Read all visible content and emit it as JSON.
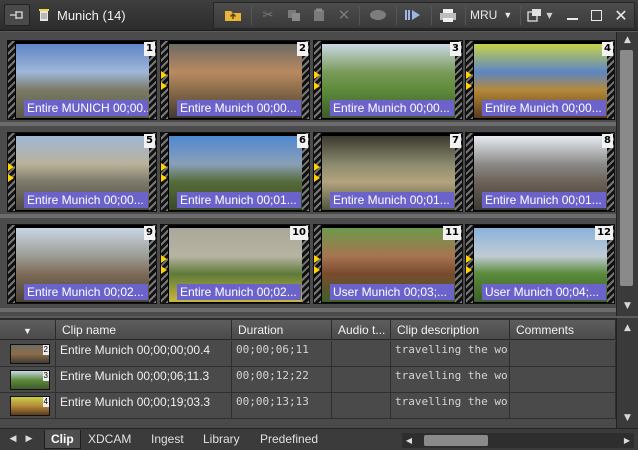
{
  "window": {
    "title": "Munich (14)",
    "mru_label": "MRU"
  },
  "icons": {
    "pin": "pin-icon",
    "trash": "trash-icon",
    "up_folder": "up-folder-icon",
    "cut": "cut-icon",
    "copy": "copy-icon",
    "paste": "paste-icon",
    "delete": "delete-icon",
    "record": "record-icon",
    "send": "send-icon",
    "print": "print-icon",
    "view": "view-options-icon",
    "minimize": "minimize-icon",
    "maximize": "maximize-icon",
    "close": "close-icon"
  },
  "clips": [
    {
      "num": "1",
      "label": "Entire MUNICH 00;00...",
      "palette": [
        "#5f86c7",
        "#9fb7d9",
        "#7a7a66",
        "#5b5a4a"
      ]
    },
    {
      "num": "2",
      "label": "Entire Munich 00;00...",
      "palette": [
        "#6f6b63",
        "#b98a62",
        "#8c6d4a",
        "#403a33"
      ]
    },
    {
      "num": "3",
      "label": "Entire Munich 00;00...",
      "palette": [
        "#c9d8e4",
        "#7a9a5a",
        "#5e8b3a",
        "#3f5a2e"
      ]
    },
    {
      "num": "4",
      "label": "Entire Munich 00;00...",
      "palette": [
        "#c7d24a",
        "#5b86c4",
        "#b5893a",
        "#5a3b1e"
      ]
    },
    {
      "num": "5",
      "label": "Entire Munich 00;00...",
      "palette": [
        "#9fb8d6",
        "#b9b29a",
        "#7d7a6b",
        "#4f4a40"
      ]
    },
    {
      "num": "6",
      "label": "Entire Munich 00;01...",
      "palette": [
        "#4f88d0",
        "#8aa0b8",
        "#556b3a",
        "#3a4a2a"
      ]
    },
    {
      "num": "7",
      "label": "Entire Munich 00;01...",
      "palette": [
        "#3a3a2e",
        "#8c8a6e",
        "#b3a37d",
        "#4e5640"
      ]
    },
    {
      "num": "8",
      "label": "Entire Munich 00;01...",
      "palette": [
        "#e7ecf2",
        "#8a8a88",
        "#6d6258",
        "#3d3a36"
      ]
    },
    {
      "num": "9",
      "label": "Entire Munich 00;02...",
      "palette": [
        "#c9d6e4",
        "#9c9c94",
        "#7d6b58",
        "#4a4238"
      ]
    },
    {
      "num": "10",
      "label": "Entire Munich 00;02...",
      "palette": [
        "#a8a79a",
        "#b8b4a2",
        "#5f7a3a",
        "#c9b73a"
      ]
    },
    {
      "num": "11",
      "label": "User Munich 00;03;...",
      "palette": [
        "#6d9a4a",
        "#a67450",
        "#7a4a2e",
        "#3e5f2a"
      ]
    },
    {
      "num": "12",
      "label": "User Munich 00;04;...",
      "palette": [
        "#8ab2dc",
        "#c0cbd4",
        "#5a8a3a",
        "#3b5f2a"
      ]
    }
  ],
  "list": {
    "columns": [
      "",
      "Clip name",
      "Duration",
      "Audio t...",
      "Clip description",
      "Comments"
    ],
    "rows": [
      {
        "num": "2",
        "name": "Entire Munich 00;00;00;00.4",
        "duration": "00;00;06;11",
        "audio": "",
        "description": "travelling the world",
        "comments": ""
      },
      {
        "num": "3",
        "name": "Entire Munich 00;00;06;11.3",
        "duration": "00;00;12;22",
        "audio": "",
        "description": "travelling the world",
        "comments": ""
      },
      {
        "num": "4",
        "name": "Entire Munich 00;00;19;03.3",
        "duration": "00;00;13;13",
        "audio": "",
        "description": "travelling the world",
        "comments": ""
      }
    ]
  },
  "tabs": [
    "Clip",
    "XDCAM",
    "Ingest",
    "Library",
    "Predefined"
  ],
  "active_tab": "Clip"
}
